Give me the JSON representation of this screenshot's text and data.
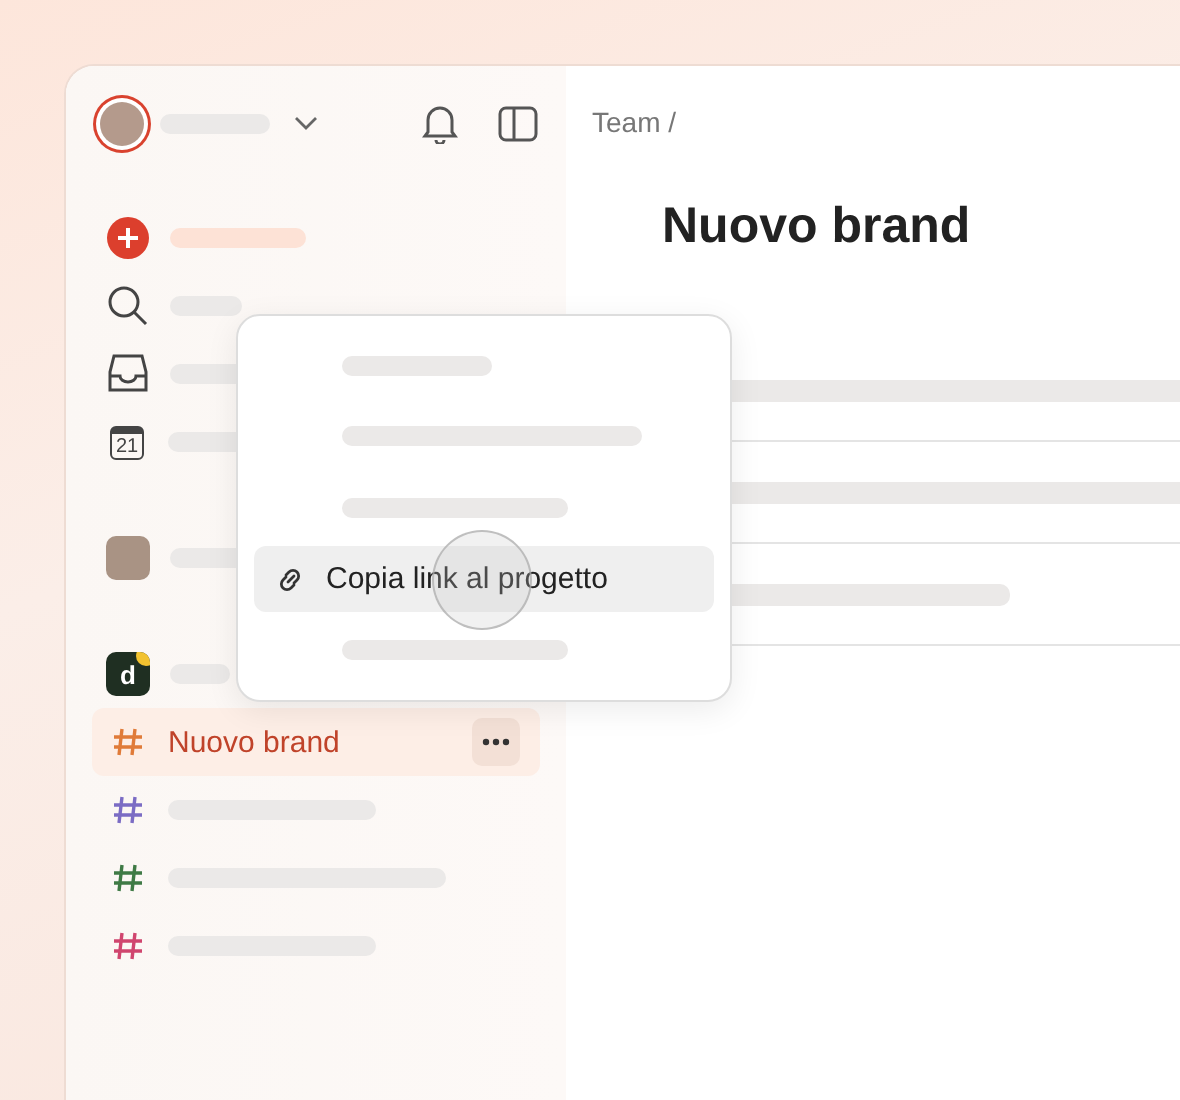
{
  "sidebar": {
    "nav": [
      {
        "kind": "add"
      },
      {
        "kind": "search"
      },
      {
        "kind": "inbox"
      },
      {
        "kind": "calendar",
        "day": "21"
      }
    ],
    "workspace_logo": "d",
    "projects": [
      {
        "name": "Nuovo brand",
        "color": "#e07b39",
        "selected": true
      },
      {
        "color": "#7b6cc4",
        "selected": false
      },
      {
        "color": "#3f7a45",
        "selected": false
      },
      {
        "color": "#d0456e",
        "selected": false
      }
    ]
  },
  "breadcrumb": "Team /",
  "title": "Nuovo brand",
  "context_menu": {
    "items": [
      {
        "kind": "placeholder",
        "selected": false
      },
      {
        "kind": "placeholder",
        "selected": false
      },
      {
        "kind": "placeholder",
        "selected": false
      },
      {
        "kind": "action",
        "label": "Copia link al progetto",
        "selected": true
      },
      {
        "kind": "placeholder",
        "selected": false
      }
    ]
  }
}
